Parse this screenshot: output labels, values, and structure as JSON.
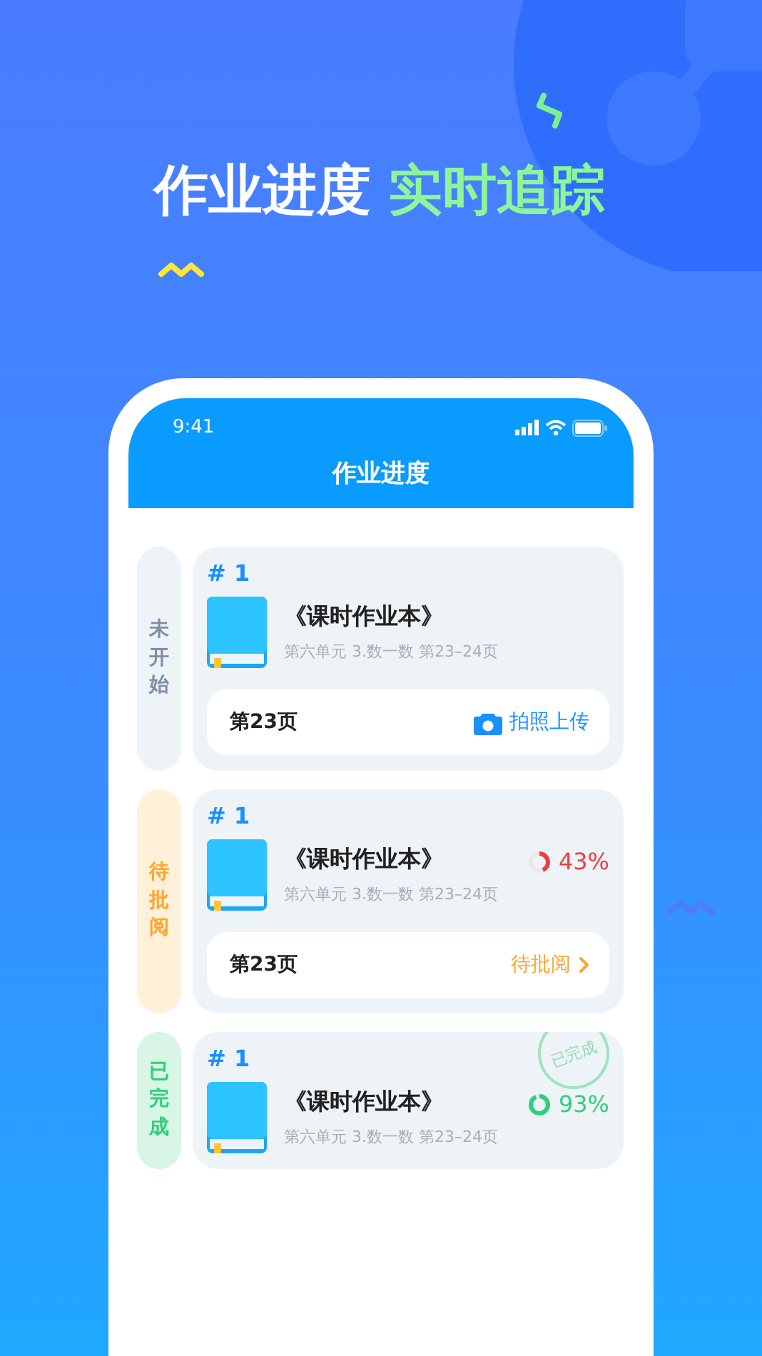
{
  "headline": {
    "main": "作业进度",
    "highlight": "实时追踪"
  },
  "status_bar": {
    "time": "9:41"
  },
  "header": {
    "title": "作业进度"
  },
  "groups": [
    {
      "kind": "not_started",
      "status": "未开始",
      "color": "#7f8fa6",
      "tasks": [
        {
          "number": "# 1",
          "book": "《课时作业本》",
          "detail": "第六单元 3.数一数 第23–24页",
          "footer": {
            "page": "第23页",
            "action": "拍照上传"
          }
        }
      ]
    },
    {
      "kind": "pending",
      "status": "待批阅",
      "color": "#ffa52e",
      "tasks": [
        {
          "number": "# 1",
          "book": "《课时作业本》",
          "detail": "第六单元 3.数一数 第23–24页",
          "progress": {
            "reading": "43%",
            "color": "#f23c3c"
          },
          "footer": {
            "page": "第23页",
            "action": "待批阅"
          }
        }
      ]
    },
    {
      "kind": "done",
      "status": "已完成",
      "color": "#2fcf7b",
      "tasks": [
        {
          "number": "# 1",
          "book": "《课时作业本》",
          "detail": "第六单元 3.数一数 第23–24页",
          "progress": {
            "reading": "93%",
            "color": "#2fcf7b"
          },
          "stamp": "已完成"
        }
      ]
    }
  ]
}
